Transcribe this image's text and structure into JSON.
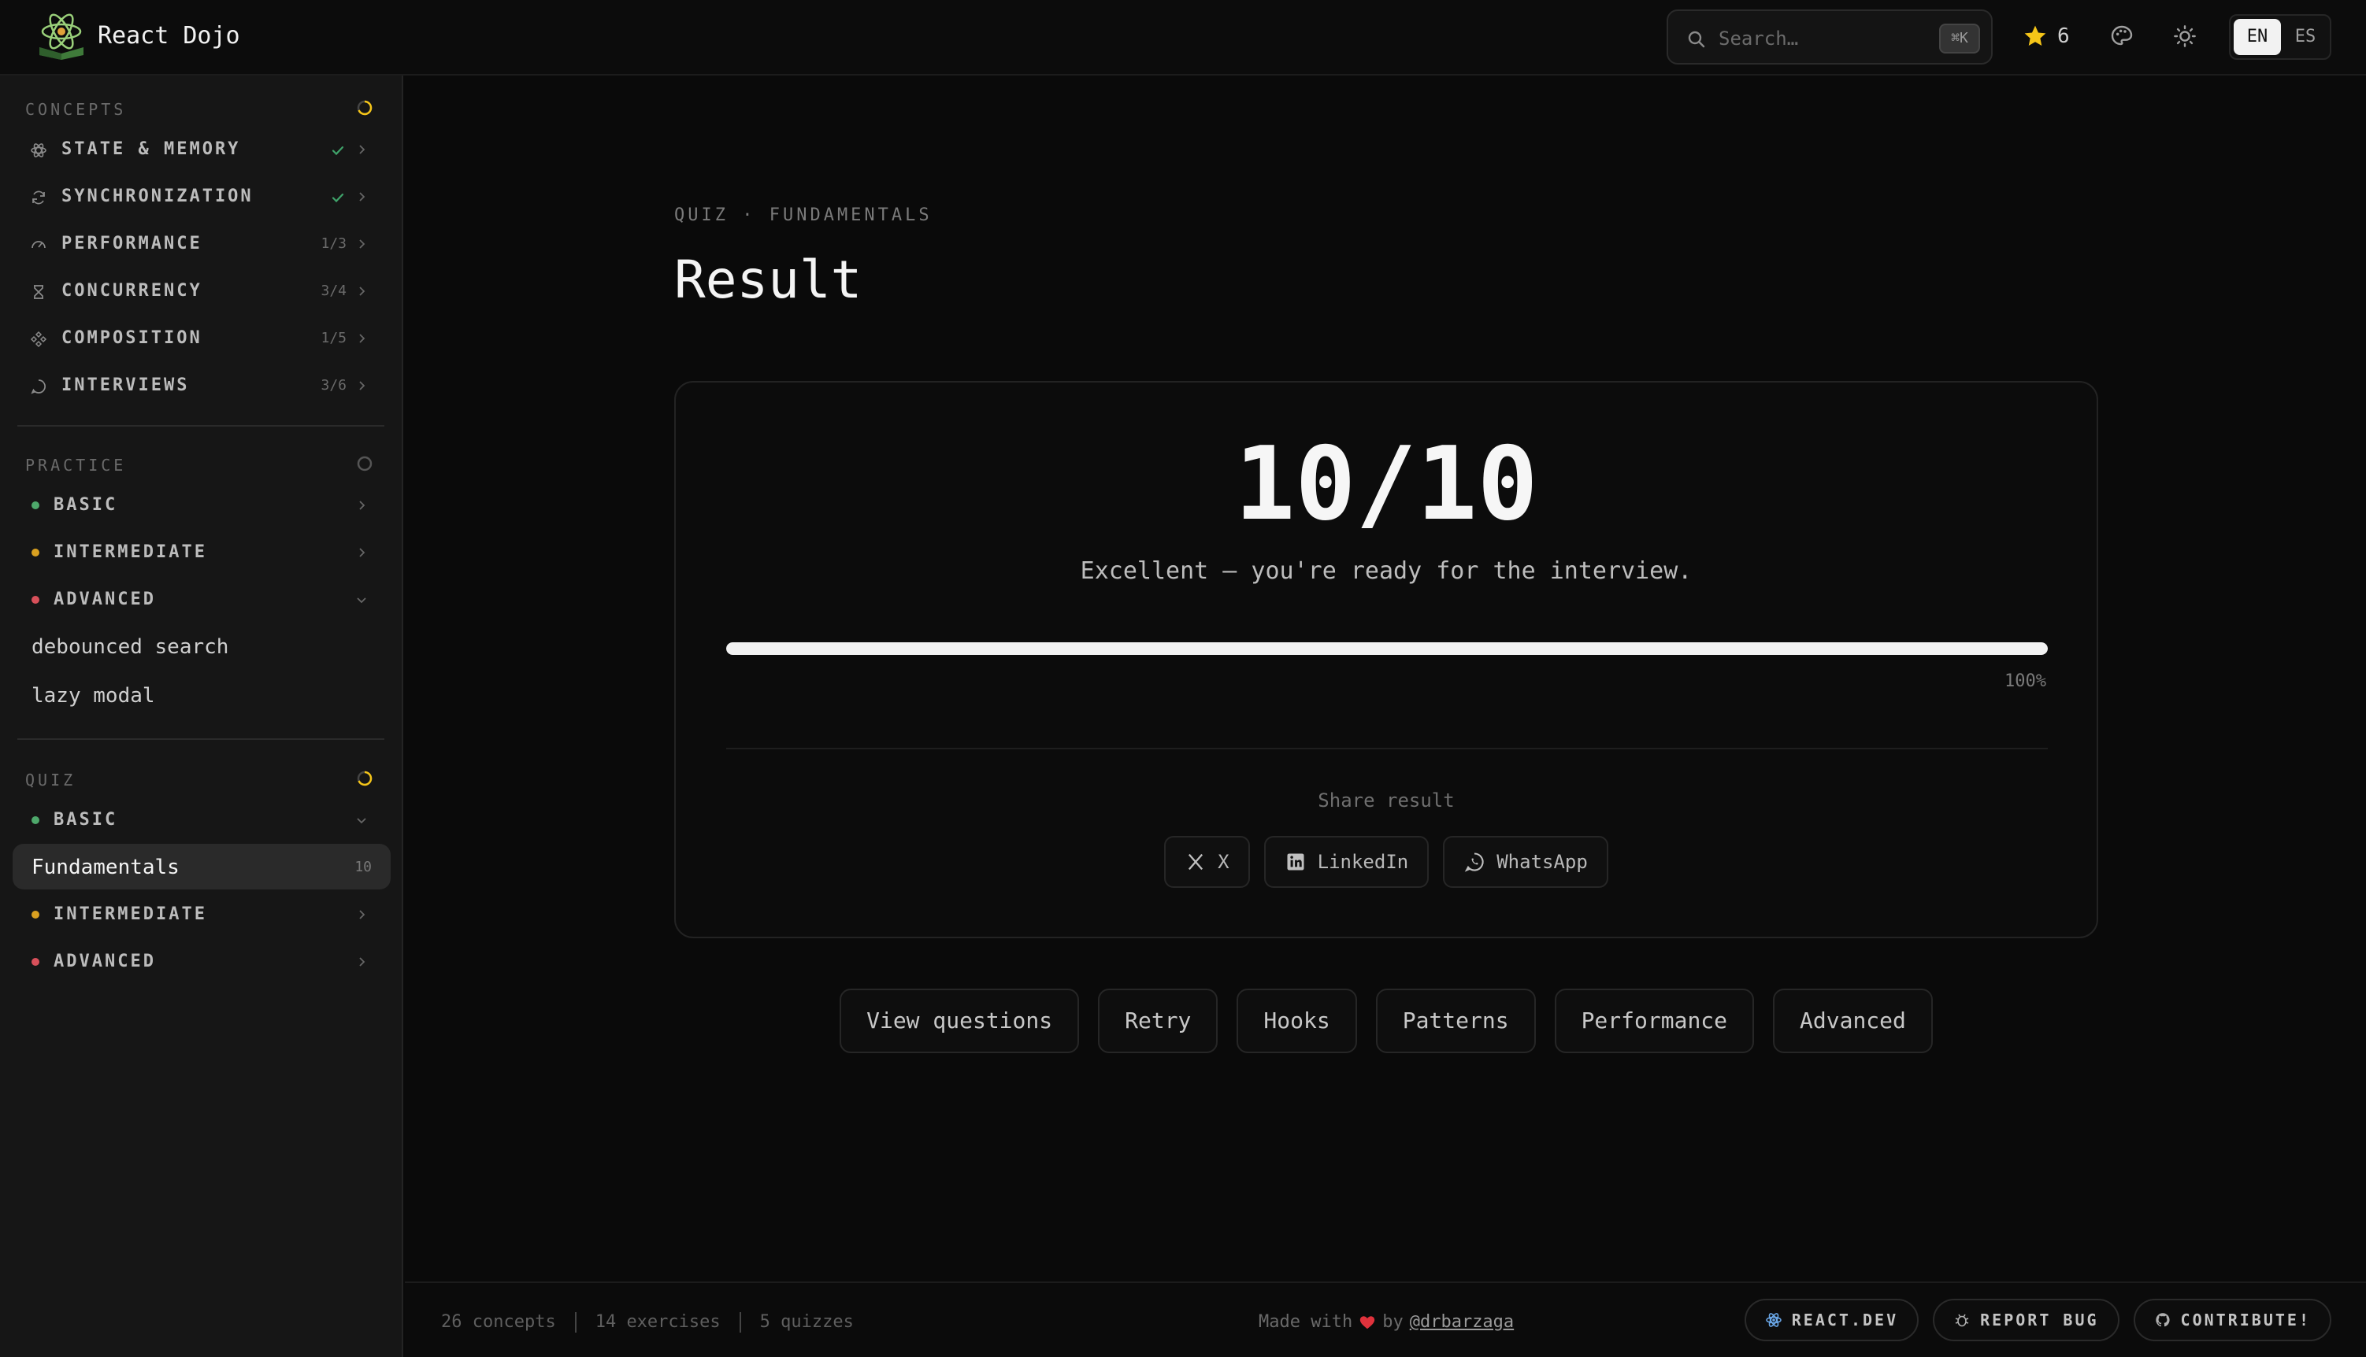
{
  "header": {
    "app_title": "React Dojo",
    "search": {
      "placeholder": "Search…",
      "shortcut": "⌘K"
    },
    "stars": "6",
    "languages": [
      "EN",
      "ES"
    ],
    "active_language": "EN"
  },
  "sidebar": {
    "concepts": {
      "title": "CONCEPTS",
      "items": [
        {
          "label": "STATE & MEMORY",
          "status": "done",
          "icon": "atom-icon"
        },
        {
          "label": "SYNCHRONIZATION",
          "status": "done",
          "icon": "sync-icon"
        },
        {
          "label": "PERFORMANCE",
          "count": "1/3",
          "icon": "gauge-icon"
        },
        {
          "label": "CONCURRENCY",
          "count": "3/4",
          "icon": "hourglass-icon"
        },
        {
          "label": "COMPOSITION",
          "count": "1/5",
          "icon": "component-icon"
        },
        {
          "label": "INTERVIEWS",
          "count": "3/6",
          "icon": "chat-icon"
        }
      ]
    },
    "practice": {
      "title": "PRACTICE",
      "items": [
        {
          "label": "BASIC",
          "color": "#4ea86b"
        },
        {
          "label": "INTERMEDIATE",
          "color": "#d9a020"
        },
        {
          "label": "ADVANCED",
          "color": "#d8505a"
        }
      ],
      "sub_items": [
        "debounced search",
        "lazy modal"
      ]
    },
    "quiz": {
      "title": "QUIZ",
      "items": [
        {
          "label": "BASIC",
          "color": "#4ea86b"
        },
        {
          "label": "INTERMEDIATE",
          "color": "#d9a020"
        },
        {
          "label": "ADVANCED",
          "color": "#d8505a"
        }
      ],
      "active_sub": {
        "label": "Fundamentals",
        "count": "10"
      }
    }
  },
  "main": {
    "breadcrumb": "QUIZ · FUNDAMENTALS",
    "title": "Result",
    "score": "10/10",
    "verdict": "Excellent — you're ready for the interview.",
    "progress_percent": 100,
    "progress_label": "100%",
    "share_label": "Share result",
    "share_buttons": [
      "X",
      "LinkedIn",
      "WhatsApp"
    ],
    "actions": [
      "View questions",
      "Retry",
      "Hooks",
      "Patterns",
      "Performance",
      "Advanced"
    ]
  },
  "footer": {
    "stats": [
      "26 concepts",
      "14 exercises",
      "5 quizzes"
    ],
    "made_with": "Made with",
    "by": "by",
    "author": "@drbarzaga",
    "links": [
      "REACT.DEV",
      "REPORT BUG",
      "CONTRIBUTE!"
    ]
  },
  "colors": {
    "accent_yellow": "#f5c518",
    "heart": "#e0323c",
    "check": "#3fa36a"
  }
}
